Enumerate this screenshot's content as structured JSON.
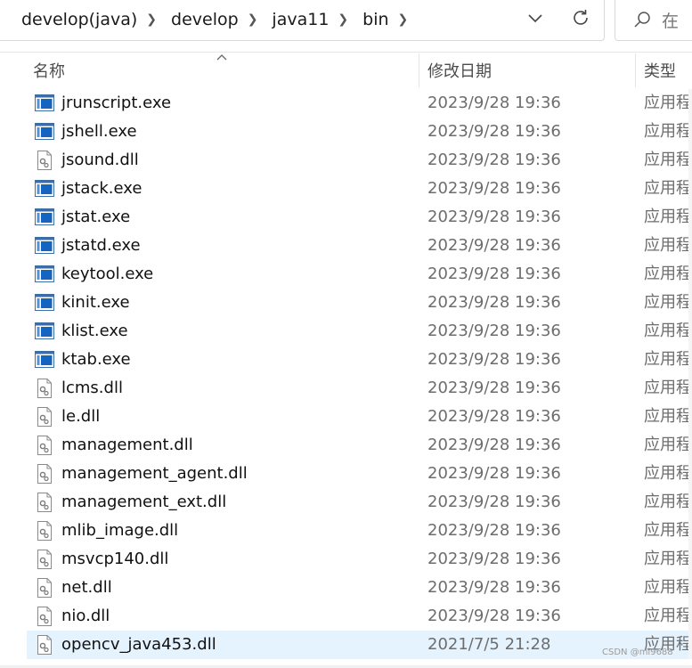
{
  "breadcrumb": [
    "develop(java)",
    "develop",
    "java11",
    "bin"
  ],
  "search": {
    "placeholder": "在"
  },
  "columns": {
    "name": "名称",
    "date": "修改日期",
    "type": "类型"
  },
  "files": [
    {
      "name": "jrunscript.exe",
      "date": "2023/9/28 19:36",
      "type": "应用程序",
      "icon": "exe-icon"
    },
    {
      "name": "jshell.exe",
      "date": "2023/9/28 19:36",
      "type": "应用程序",
      "icon": "exe-icon"
    },
    {
      "name": "jsound.dll",
      "date": "2023/9/28 19:36",
      "type": "应用程序扩展",
      "icon": "dll-icon"
    },
    {
      "name": "jstack.exe",
      "date": "2023/9/28 19:36",
      "type": "应用程序",
      "icon": "exe-icon"
    },
    {
      "name": "jstat.exe",
      "date": "2023/9/28 19:36",
      "type": "应用程序",
      "icon": "exe-icon"
    },
    {
      "name": "jstatd.exe",
      "date": "2023/9/28 19:36",
      "type": "应用程序",
      "icon": "exe-icon"
    },
    {
      "name": "keytool.exe",
      "date": "2023/9/28 19:36",
      "type": "应用程序",
      "icon": "exe-icon"
    },
    {
      "name": "kinit.exe",
      "date": "2023/9/28 19:36",
      "type": "应用程序",
      "icon": "exe-icon"
    },
    {
      "name": "klist.exe",
      "date": "2023/9/28 19:36",
      "type": "应用程序",
      "icon": "exe-icon"
    },
    {
      "name": "ktab.exe",
      "date": "2023/9/28 19:36",
      "type": "应用程序",
      "icon": "exe-icon"
    },
    {
      "name": "lcms.dll",
      "date": "2023/9/28 19:36",
      "type": "应用程序扩展",
      "icon": "dll-icon"
    },
    {
      "name": "le.dll",
      "date": "2023/9/28 19:36",
      "type": "应用程序扩展",
      "icon": "dll-icon"
    },
    {
      "name": "management.dll",
      "date": "2023/9/28 19:36",
      "type": "应用程序扩展",
      "icon": "dll-icon"
    },
    {
      "name": "management_agent.dll",
      "date": "2023/9/28 19:36",
      "type": "应用程序扩展",
      "icon": "dll-icon"
    },
    {
      "name": "management_ext.dll",
      "date": "2023/9/28 19:36",
      "type": "应用程序扩展",
      "icon": "dll-icon"
    },
    {
      "name": "mlib_image.dll",
      "date": "2023/9/28 19:36",
      "type": "应用程序扩展",
      "icon": "dll-icon"
    },
    {
      "name": "msvcp140.dll",
      "date": "2023/9/28 19:36",
      "type": "应用程序扩展",
      "icon": "dll-icon"
    },
    {
      "name": "net.dll",
      "date": "2023/9/28 19:36",
      "type": "应用程序扩展",
      "icon": "dll-icon"
    },
    {
      "name": "nio.dll",
      "date": "2023/9/28 19:36",
      "type": "应用程序扩展",
      "icon": "dll-icon"
    },
    {
      "name": "opencv_java453.dll",
      "date": "2021/7/5 21:28",
      "type": "应用程序扩展",
      "icon": "dll-icon",
      "selected": true
    }
  ],
  "watermark": "CSDN @mi9688",
  "colors": {
    "selected_row": "#e5f3ff",
    "exe_icon_blue": "#1565c0",
    "date_text": "#6d6d6d"
  }
}
